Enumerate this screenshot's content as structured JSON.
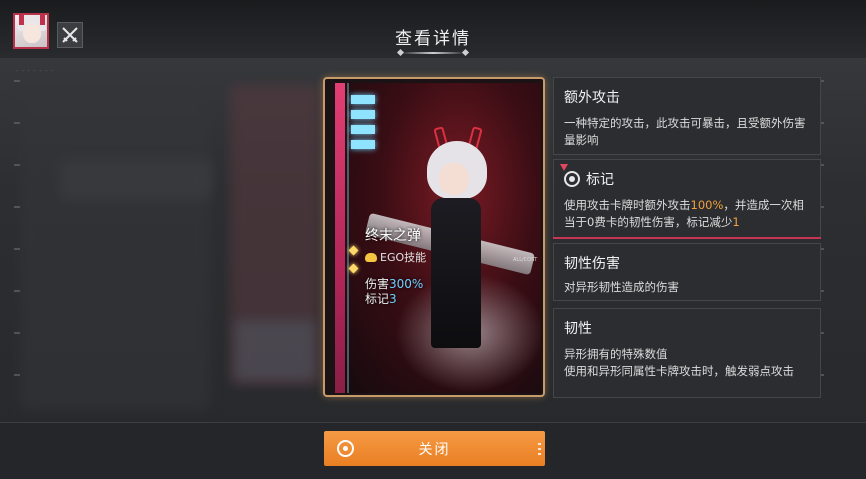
{
  "header": {
    "title": "查看详情",
    "avatar_icon": "character-portrait-icon",
    "tool_icon": "crossed-swords-icon"
  },
  "card": {
    "name": "终末之弹",
    "type_label": "EGO技能",
    "damage_label": "伤害",
    "damage_value": "300%",
    "mark_label": "标记",
    "mark_value": "3",
    "corner_tag": "ALL/COST",
    "accent_color": "#6fcfff"
  },
  "panels": [
    {
      "title": "额外攻击",
      "desc": "一种特定的攻击，此攻击可暴击，且受额外伤害量影响"
    },
    {
      "title": "标记",
      "icon": "target-mark-icon",
      "desc_prefix": "使用攻击卡牌时额外攻击",
      "desc_highlight1": "100%",
      "desc_mid": "，并造成一次相当于0费卡的韧性伤害，标记减少",
      "desc_highlight2": "1",
      "highlight_color": "#f3a03d"
    },
    {
      "title": "韧性伤害",
      "desc": "对异形韧性造成的伤害"
    },
    {
      "title": "韧性",
      "desc_line1": "异形拥有的特殊数值",
      "desc_line2": "使用和异形同属性卡牌攻击时，触发弱点攻击"
    }
  ],
  "footer": {
    "close_label": "关闭",
    "button_color": "#f08a2e"
  }
}
